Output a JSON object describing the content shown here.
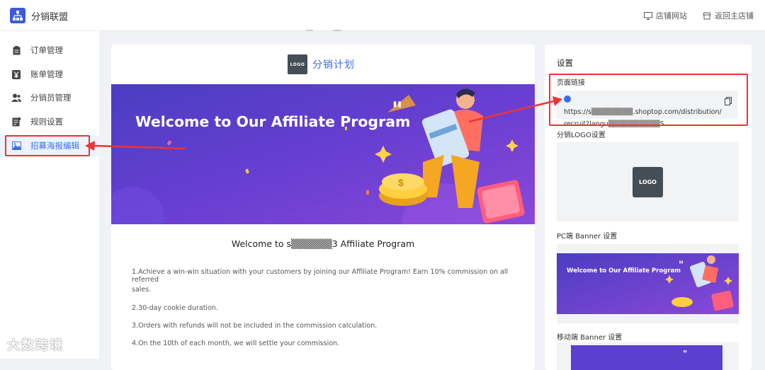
{
  "header": {
    "app_name": "分销联盟",
    "store_site": "店铺网站",
    "back_to_store": "返回主店铺"
  },
  "sidebar": {
    "items": [
      {
        "label": "订单管理",
        "icon": "clipboard-icon"
      },
      {
        "label": "账单管理",
        "icon": "yen-icon"
      },
      {
        "label": "分销员管理",
        "icon": "users-icon"
      },
      {
        "label": "规则设置",
        "icon": "rules-icon"
      },
      {
        "label": "招募海报编辑",
        "icon": "image-icon"
      }
    ]
  },
  "preview": {
    "logo_text": "LOGO",
    "plan_title": "分销计划",
    "banner_text": "Welcome to Our Affiliate Program",
    "welcome_title": "Welcome to s▒▒▒▒▒▒3 Affiliate Program",
    "rules": [
      "1.Achieve a win-win situation with your customers by joining our Affiliate Program! Earn 10% commission on all referred",
      "sales.",
      "2.30-day cookie duration.",
      "3.Orders with refunds will not be included in the commission calculation.",
      "4.On the 10th of each month, we will settle your commission."
    ]
  },
  "settings": {
    "title": "设置",
    "page_link_label": "页面链接",
    "page_link_line1": "https://s▒▒▒▒▒▒▒▒.shoptop.com/distribution/",
    "page_link_line2": "recruit?langu▒▒▒▒▒▒▒▒▒▒S",
    "logo_label": "分销LOGO设置",
    "logo_text": "LOGO",
    "pc_banner_label": "PC端 Banner 设置",
    "pc_banner_text": "Welcome to Our Affiliate Program",
    "mobile_banner_label": "移动端 Banner 设置"
  },
  "watermark": "大数跨境",
  "colors": {
    "accent": "#3b6ce8",
    "annotation_red": "#e53333",
    "banner_purple": "#5b3fc9"
  }
}
